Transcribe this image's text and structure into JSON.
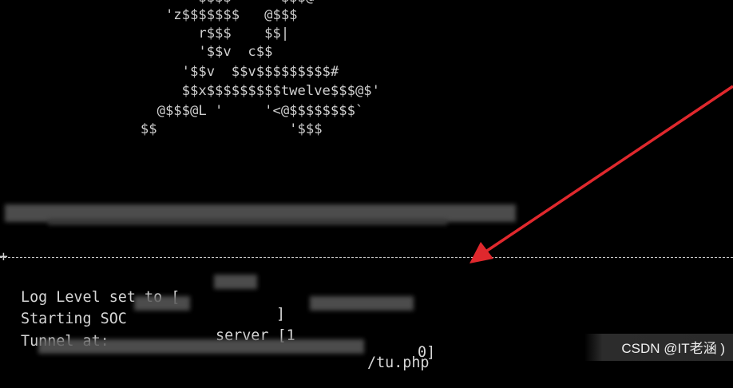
{
  "ascii_banner": [
    "                        $$$$      $$$@",
    "                    'z$$$$$$$   @$$$",
    "                        r$$$    $$|",
    "                        '$$v  c$$",
    "                      '$$v  $$v$$$$$$$$$#",
    "                      $$x$$$$$$$$$twelve$$$@$'",
    "                   @$$$@L '     '<@$$$$$$$$`",
    "                 $$                '$$$"
  ],
  "output": {
    "log_level": "Log Level set to [",
    "log_level_end": "]",
    "starting_a": "Starting SOC",
    "starting_b": "server [1",
    "starting_end": "0]",
    "tunnel": "Tunnel at:",
    "tunnel_path": "/tu.php"
  },
  "watermark": "CSDN @IT老涵 )",
  "colors": {
    "background": "#000000",
    "text": "#d0d0d0",
    "arrow": "#e0282d"
  }
}
